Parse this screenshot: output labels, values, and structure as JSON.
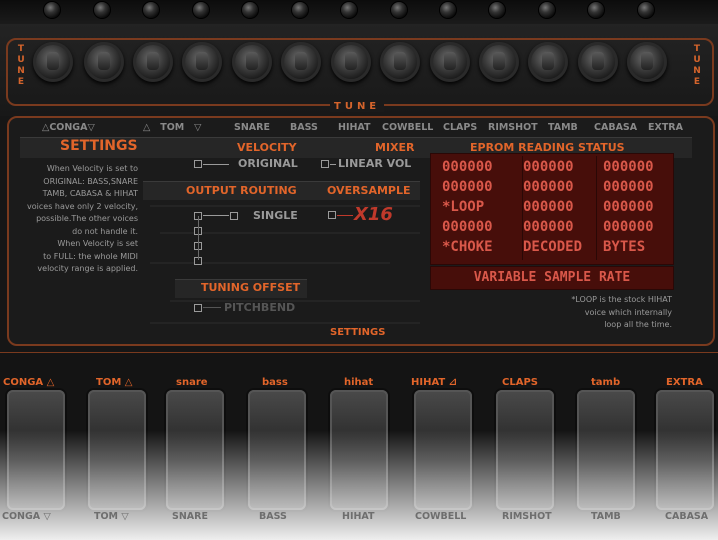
{
  "tune": {
    "left": "TUNE",
    "right": "TUNE",
    "center": "TUNE"
  },
  "voices": [
    "CONGA",
    "TOM",
    "SNARE",
    "BASS",
    "HIHAT",
    "COWBELL",
    "CLAPS",
    "RIMSHOT",
    "TAMB",
    "CABASA",
    "EXTRA"
  ],
  "settings": {
    "title": "SETTINGS",
    "velocity": "VELOCITY",
    "mixer": "MIXER",
    "eprom": "EPROM READING STATUS",
    "original": "ORIGINAL",
    "linear_vol": "LINEAR VOL",
    "output_routing": "OUTPUT ROUTING",
    "oversample": "OVERSAMPLE",
    "single": "SINGLE",
    "x16": "X16",
    "tuning_offset": "TUNING OFFSET",
    "pitchbend": "PITCHBEND",
    "footer": "SETTINGS"
  },
  "help_text": [
    "When Velocity is set to",
    "ORIGINAL: BASS,SNARE",
    "TAMB, CABASA & HIHAT",
    "voices have only 2 velocity,",
    "possible.The other voices",
    "do not handle it.",
    "When Velocity is set",
    "to FULL: the whole MIDI",
    "velocity range is applied."
  ],
  "eprom_grid": [
    [
      "000000",
      "000000",
      "000000"
    ],
    [
      "000000",
      "000000",
      "000000"
    ],
    [
      "*LOOP",
      "000000",
      "000000"
    ],
    [
      "000000",
      "000000",
      "000000"
    ],
    [
      "*CHOKE",
      "DECODED",
      "BYTES"
    ]
  ],
  "variable_sample_rate": "VARIABLE SAMPLE RATE",
  "loop_note": [
    "*LOOP is the stock HIHAT",
    "voice which internally",
    "loop all the time."
  ],
  "pads_top": [
    "CONGA △",
    "TOM △",
    "snare",
    "bass",
    "hihat",
    "HIHAT",
    "CLAPS",
    "tamb",
    "EXTRA"
  ],
  "pads_bottom": [
    "CONGA ▽",
    "TOM ▽",
    "SNARE",
    "BASS",
    "HIHAT",
    "COWBELL",
    "RIMSHOT",
    "TAMB",
    "CABASA"
  ],
  "colors": {
    "accent": "#e2652a",
    "display_bg": "#470e0a",
    "display_text": "#d9584a"
  }
}
